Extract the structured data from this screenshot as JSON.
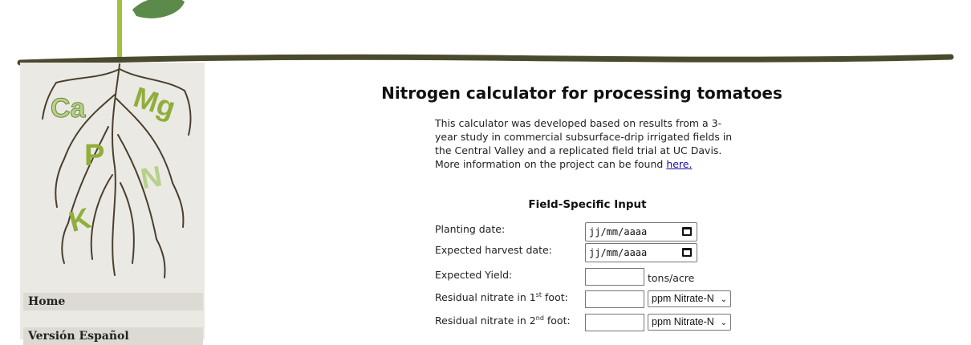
{
  "sidebar": {
    "nav": [
      {
        "label": "Home"
      },
      {
        "label": "Versión Español"
      }
    ],
    "logo_letters": [
      "Ca",
      "Mg",
      "P",
      "N",
      "K"
    ]
  },
  "main": {
    "title": "Nitrogen calculator for processing tomatoes",
    "intro": {
      "text": "This calculator was developed based on results from a 3-year study in commercial subsurface-drip irrigated fields in the Central Valley and a replicated field trial at UC Davis. More information on the project can be found",
      "link_label": "here."
    },
    "form": {
      "section_title": "Field-Specific Input",
      "planting_date": {
        "label": "Planting date:",
        "placeholder": "jj/mm/aaaa"
      },
      "harvest_date": {
        "label": "Expected harvest date:",
        "placeholder": "jj/mm/aaaa"
      },
      "yield": {
        "label": "Expected Yield:",
        "value": "",
        "unit": "tons/acre"
      },
      "nitrate_1": {
        "label_pre": "Residual nitrate in 1",
        "sup": "st",
        "label_post": " foot:",
        "value": "",
        "unit_selected": "ppm Nitrate-N"
      },
      "nitrate_2": {
        "label_pre": "Residual nitrate in 2",
        "sup": "nd",
        "label_post": " foot:",
        "value": "",
        "unit_selected": "ppm Nitrate-N"
      }
    }
  },
  "colors": {
    "soil_line": "#4a4a2e",
    "stem": "#9fc13c",
    "leaf": "#5c8a4a",
    "sidebar_bg": "#ebe9e4",
    "nav_bg": "#dcdad3",
    "link": "#1a0dab"
  },
  "icons": [
    "calendar-icon",
    "chevron-down-icon"
  ]
}
